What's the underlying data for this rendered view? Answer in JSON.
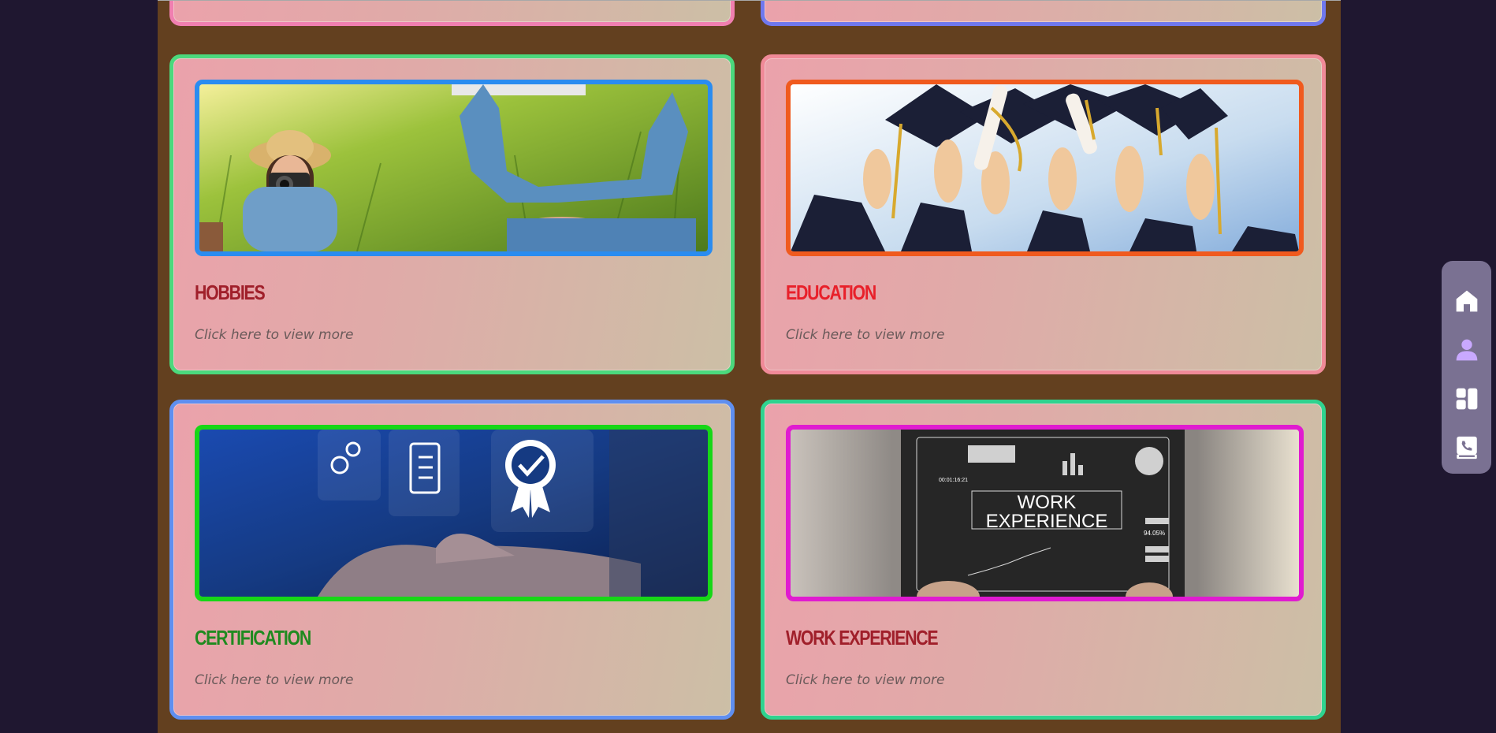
{
  "cards": [
    {
      "title": "Hobbies",
      "subtitle": "Click here to view more",
      "title_color": "#a01f2a",
      "border_color": "#4bd97d",
      "frame_color": "#2a8cf0"
    },
    {
      "title": "Education",
      "subtitle": "Click here to view more",
      "title_color": "#e8202a",
      "border_color": "#f08a98",
      "frame_color": "#f05a1e"
    },
    {
      "title": "Certification",
      "subtitle": "Click here to view more",
      "title_color": "#1f8a1f",
      "border_color": "#5f8ff0",
      "frame_color": "#17d717"
    },
    {
      "title": "Work Experience",
      "subtitle": "Click here to view more",
      "title_color": "#a01f2a",
      "border_color": "#2fd38f",
      "frame_color": "#e01bd0"
    }
  ],
  "work_image_text": {
    "line1": "WORK",
    "line2": "EXPERIENCE",
    "stat": "94.05%",
    "time": "00:01:16:21"
  },
  "dock": {
    "items": [
      {
        "name": "home-icon",
        "color": "#ffffff"
      },
      {
        "name": "person-icon",
        "color": "#c9a9ff"
      },
      {
        "name": "dashboard-icon",
        "color": "#ffffff"
      },
      {
        "name": "contact-book-icon",
        "color": "#ffffff"
      }
    ]
  }
}
